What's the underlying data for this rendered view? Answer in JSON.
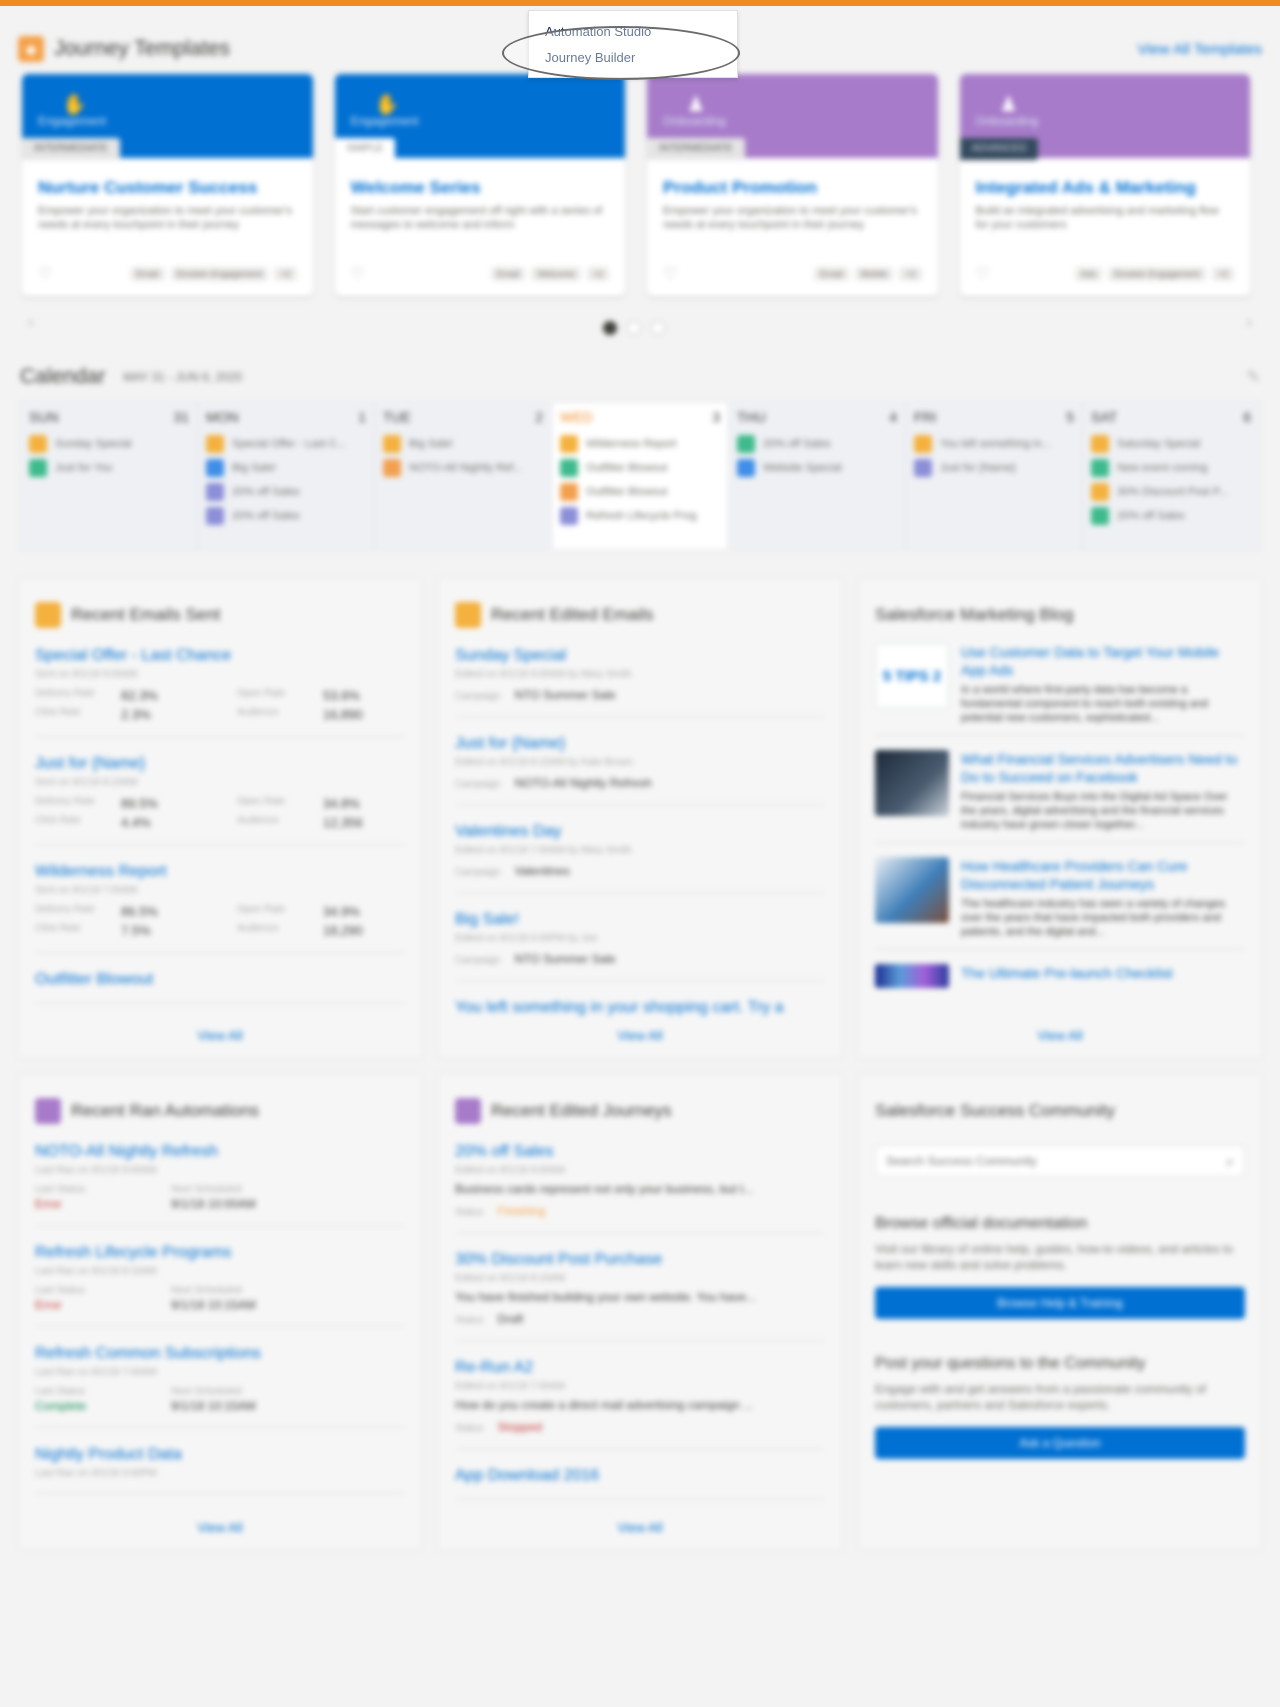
{
  "journey_templates": {
    "title": "Journey Templates",
    "view_all": "View All Templates",
    "cards": [
      {
        "category": "Engagement",
        "badge": "INTERMEDIATE",
        "title": "Nurture Customer Success",
        "desc": "Empower your organization to meet your customer's needs at every touchpoint in their journey",
        "chips": [
          "Email",
          "Einstein Engagement",
          "+2"
        ]
      },
      {
        "category": "Engagement",
        "badge": "SIMPLE",
        "title": "Welcome Series",
        "desc": "Start customer engagement off right with a series of messages to welcome and inform",
        "chips": [
          "Email",
          "Welcome",
          "+2"
        ]
      },
      {
        "category": "Onboarding",
        "badge": "INTERMEDIATE",
        "title": "Product Promotion",
        "desc": "Empower your organization to meet your customer's needs at every touchpoint in their journey",
        "chips": [
          "Email",
          "Mobile",
          "+2"
        ]
      },
      {
        "category": "Onboarding",
        "badge": "ADVANCED",
        "title": "Integrated Ads & Marketing",
        "desc": "Build an integrated advertising and marketing flow for your customers",
        "chips": [
          "Ads",
          "Einstein Engagement",
          "+2"
        ]
      }
    ]
  },
  "calendar": {
    "title": "Calendar",
    "range": "MAY 31 - JUN 6, 2020",
    "days": [
      {
        "name": "SUN",
        "num": "31",
        "events": [
          {
            "label": "Sunday Special",
            "color": "orange"
          },
          {
            "label": "Just for You",
            "color": "green"
          }
        ]
      },
      {
        "name": "MON",
        "num": "1",
        "events": [
          {
            "label": "Special Offer - Last C...",
            "color": "orange"
          },
          {
            "label": "Big Sale!",
            "color": "blue"
          },
          {
            "label": "20% off Sales",
            "color": "lav"
          },
          {
            "label": "20% off Sales",
            "color": "lav"
          }
        ]
      },
      {
        "name": "TUE",
        "num": "2",
        "events": [
          {
            "label": "Big Sale!",
            "color": "orange"
          },
          {
            "label": "NOTO-All Nightly Ref...",
            "color": "peach"
          }
        ]
      },
      {
        "name": "WED",
        "num": "3",
        "events": [
          {
            "label": "Wilderness Report",
            "color": "orange"
          },
          {
            "label": "Outfitter Blowout",
            "color": "green"
          },
          {
            "label": "Outfitter Blowout",
            "color": "peach"
          },
          {
            "label": "Refresh Lifecycle Prog",
            "color": "lav"
          }
        ]
      },
      {
        "name": "THU",
        "num": "4",
        "events": [
          {
            "label": "20% off Sales",
            "color": "green"
          },
          {
            "label": "Website Special",
            "color": "blue"
          }
        ]
      },
      {
        "name": "FRI",
        "num": "5",
        "events": [
          {
            "label": "You left something in...",
            "color": "orange"
          },
          {
            "label": "Just for {Name}",
            "color": "lav"
          }
        ]
      },
      {
        "name": "SAT",
        "num": "6",
        "events": [
          {
            "label": "Saturday Special",
            "color": "orange"
          },
          {
            "label": "New event coming",
            "color": "green"
          },
          {
            "label": "30% Discount Post P...",
            "color": "orange"
          },
          {
            "label": "20% off Sales",
            "color": "green"
          }
        ]
      }
    ]
  },
  "recent_emails_sent": {
    "title": "Recent Emails Sent",
    "labels": {
      "delivery": "Delivery Rate",
      "open": "Open Rate",
      "click": "Click Rate",
      "audience": "Audience"
    },
    "items": [
      {
        "title": "Special Offer - Last Chance",
        "sub": "Sent on 9/1/18 9:00AM",
        "delivery": "82.3%",
        "open": "53.6%",
        "click": "2.3%",
        "audience": "16,890"
      },
      {
        "title": "Just for {Name}",
        "sub": "Sent on 9/1/18 8:15AM",
        "delivery": "89.5%",
        "open": "34.8%",
        "click": "4.4%",
        "audience": "12,356"
      },
      {
        "title": "Wilderness Report",
        "sub": "Sent on 9/1/18 7:00AM",
        "delivery": "86.5%",
        "open": "34.9%",
        "click": "7.5%",
        "audience": "18,290"
      },
      {
        "title": "Outfitter Blowout"
      }
    ],
    "view_all": "View All"
  },
  "recent_edited_emails": {
    "title": "Recent Edited Emails",
    "campaign_label": "Campaign",
    "items": [
      {
        "title": "Sunday Special",
        "sub": "Edited on 9/1/18 9:00AM by Mary Smith",
        "campaign": "NTO Summer Sale"
      },
      {
        "title": "Just for {Name}",
        "sub": "Edited on 9/1/18 8:15AM by Kate Brown",
        "campaign": "NOTO-All Nightly Refresh"
      },
      {
        "title": "Valentines Day",
        "sub": "Edited on 9/1/18 7:00AM by Mary Smith",
        "campaign": "Valentines"
      },
      {
        "title": "Big Sale!",
        "sub": "Edited on 9/1/18 6:00PM by Joe",
        "campaign": "NTO Summer Sale"
      },
      {
        "title": "You left something in your shopping cart. Try a"
      }
    ],
    "view_all": "View All"
  },
  "marketing_blog": {
    "title": "Salesforce Marketing Blog",
    "thumb1_text": "5 TIPS 2",
    "items": [
      {
        "title": "Use Customer Data to Target Your Mobile App Ads",
        "desc": "In a world where first-party data has become a fundamental component to reach both existing and potential new customers, sophisticated..."
      },
      {
        "title": "What Financial Services Advertisers Need to Do to Succeed on Facebook",
        "desc": "Financial Services Buys into the Digital Ad Space Over the years, digital advertising and the financial services industry have grown closer together..."
      },
      {
        "title": "How Healthcare Providers Can Cure Disconnected Patient Journeys",
        "desc": "The healthcare industry has seen a variety of changes over the years that have impacted both providers and patients, and the digital and..."
      },
      {
        "title": "The Ultimate Pre-launch Checklist"
      }
    ],
    "view_all": "View All"
  },
  "recent_run_automations": {
    "title": "Recent Ran Automations",
    "labels": {
      "last_status": "Last Status",
      "next": "Next Scheduled"
    },
    "items": [
      {
        "title": "NOTO-All Nightly Refresh",
        "sub": "Last Ran on 9/1/18 9:00AM",
        "status": "Error",
        "status_kind": "error",
        "next": "9/1/18 10:00AM"
      },
      {
        "title": "Refresh Lifecycle Programs",
        "sub": "Last Ran on 9/1/18 8:15AM",
        "status": "Error",
        "status_kind": "error",
        "next": "9/1/18 10:15AM"
      },
      {
        "title": "Refresh Common Subscriptions",
        "sub": "Last Ran on 9/1/18 7:00AM",
        "status": "Complete",
        "status_kind": "complete",
        "next": "9/1/18 10:15AM"
      },
      {
        "title": "Nightly Product Data",
        "sub": "Last Ran on 9/1/18 3:00PM"
      }
    ],
    "view_all": "View All"
  },
  "recent_edited_journeys": {
    "title": "Recent Edited Journeys",
    "status_label": "Status",
    "items": [
      {
        "title": "20% off Sales",
        "sub": "Edited on 9/1/18 9:00AM",
        "desc": "Business cards represent not only your business, but t...",
        "status": "Finishing",
        "status_kind": "finishing"
      },
      {
        "title": "30% Discount Post Purchase",
        "sub": "Edited on 9/1/18 8:15AM",
        "desc": "You have finished building your own website. You have...",
        "status": "Draft",
        "status_kind": "draft"
      },
      {
        "title": "Re-Run A2",
        "sub": "Edited on 9/1/18 7:00AM",
        "desc": "How do you create a direct mail advertising campaign ...",
        "status": "Stopped",
        "status_kind": "stopped"
      },
      {
        "title": "App Download 2016"
      }
    ],
    "view_all": "View All"
  },
  "success_community": {
    "title": "Salesforce Success Community",
    "search_placeholder": "Search Success Community",
    "doc_heading": "Browse official documentation",
    "doc_text": "Visit our library of online help, guides, how-to videos, and articles to learn new skills and solve problems.",
    "doc_button": "Browse Help & Training",
    "ask_heading": "Post your questions to the Community",
    "ask_text": "Engage with and get answers from a passionate community of customers, partners and Salesforce experts.",
    "ask_button": "Ask a Question"
  },
  "dropdown": {
    "items": [
      "Automation Studio",
      "Journey Builder"
    ]
  },
  "colors": {
    "accent": "#0070d2",
    "topbar": "#f08a24",
    "purple": "#a77bca"
  }
}
